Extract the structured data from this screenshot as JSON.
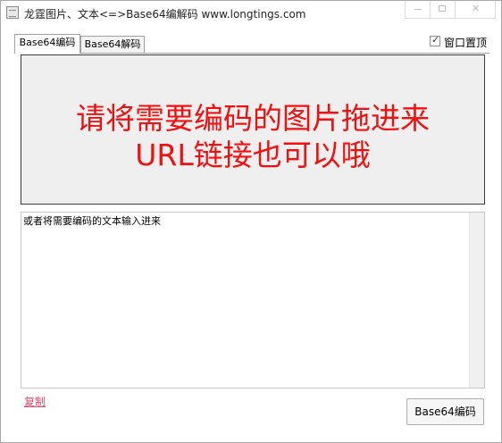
{
  "window": {
    "title": "龙霆图片、文本<=>Base64编解码 www.longtings.com",
    "close_glyph": "✕"
  },
  "tabs": [
    {
      "label": "Base64编码",
      "active": true
    },
    {
      "label": "Base64解码",
      "active": false
    }
  ],
  "topmost": {
    "label": "窗口置顶",
    "checked": true,
    "check_glyph": "✓"
  },
  "dropzone": {
    "line1": "请将需要编码的图片拖进来",
    "line2": "URL链接也可以哦",
    "text_color": "#f01010"
  },
  "input": {
    "value": "或者将需要编码的文本输入进来"
  },
  "copy_link": {
    "label": "复制",
    "color": "#e04a6a"
  },
  "encode_button": {
    "label": "Base64编码"
  }
}
